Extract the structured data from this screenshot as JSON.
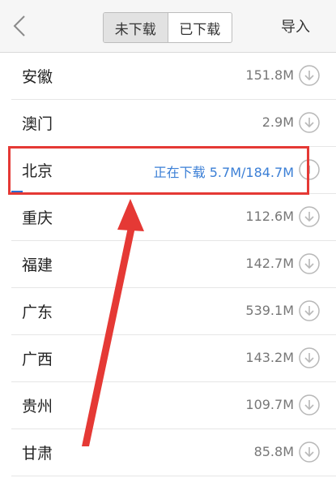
{
  "header": {
    "back_icon": "chevron-left-icon",
    "tabs": [
      {
        "label": "未下载",
        "active": true
      },
      {
        "label": "已下载",
        "active": false
      }
    ],
    "import_label": "导入"
  },
  "list": {
    "items": [
      {
        "name": "安徽",
        "size": "151.8M",
        "icon": "download-icon"
      },
      {
        "name": "澳门",
        "size": "2.9M",
        "icon": "download-icon"
      },
      {
        "name": "北京",
        "status": "正在下载",
        "size": "5.7M/184.7M",
        "icon": "pause-icon",
        "downloading": true
      },
      {
        "name": "重庆",
        "size": "112.6M",
        "icon": "download-icon"
      },
      {
        "name": "福建",
        "size": "142.7M",
        "icon": "download-icon"
      },
      {
        "name": "广东",
        "size": "539.1M",
        "icon": "download-icon"
      },
      {
        "name": "广西",
        "size": "143.2M",
        "icon": "download-icon"
      },
      {
        "name": "贵州",
        "size": "109.7M",
        "icon": "download-icon"
      },
      {
        "name": "甘肃",
        "size": "85.8M",
        "icon": "download-icon"
      }
    ]
  },
  "colors": {
    "accent": "#3b7fd6",
    "annotation": "#e53935"
  }
}
